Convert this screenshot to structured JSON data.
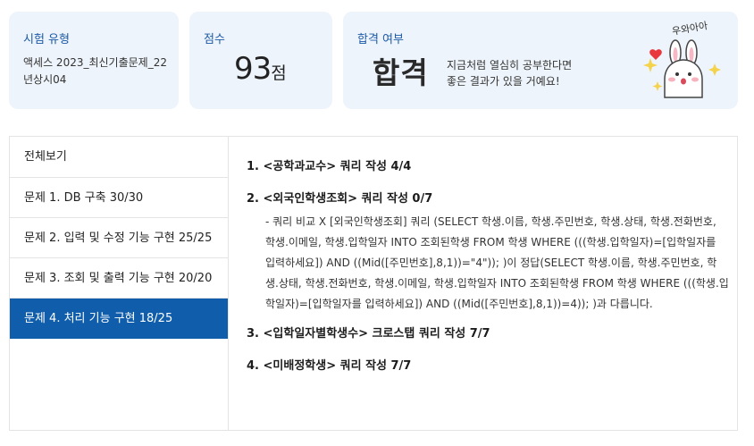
{
  "cards": {
    "exam_type": {
      "label": "시험 유형",
      "value": "액세스 2023_최신기출문제_22년상시04"
    },
    "score": {
      "label": "점수",
      "value": "93",
      "unit": "점"
    },
    "result": {
      "label": "합격 여부",
      "value": "합격",
      "message_line1": "지금처럼 열심히 공부한다면",
      "message_line2": "좋은 결과가 있을 거예요!",
      "mascot_text": "우와아아"
    }
  },
  "sidebar": {
    "items": [
      {
        "label": "전체보기",
        "active": false
      },
      {
        "label": "문제 1. DB 구축 30/30",
        "active": false
      },
      {
        "label": "문제 2. 입력 및 수정 기능 구현 25/25",
        "active": false
      },
      {
        "label": "문제 3. 조회 및 출력 기능 구현 20/20",
        "active": false
      },
      {
        "label": "문제 4. 처리 기능 구현 18/25",
        "active": true
      }
    ]
  },
  "questions": [
    {
      "title": "1. <공학과교수> 쿼리 작성 4/4"
    },
    {
      "title": "2. <외국인학생조회> 쿼리 작성 0/7",
      "detail": "- 쿼리 비교 X [외국인학생조회] 쿼리 (SELECT 학생.이름, 학생.주민번호, 학생.상태, 학생.전화번호, 학생.이메일, 학생.입학일자 INTO 조회된학생 FROM 학생 WHERE (((학생.입학일자)=[입학일자를 입력하세요]) AND ((Mid([주민번호],8,1))=\"4\")); )이 정답(SELECT 학생.이름, 학생.주민번호, 학생.상태, 학생.전화번호, 학생.이메일, 학생.입학일자 INTO 조회된학생 FROM 학생 WHERE (((학생.입학일자)=[입학일자를 입력하세요]) AND ((Mid([주민번호],8,1))=4)); )과 다릅니다."
    },
    {
      "title": "3. <입학일자별학생수> 크로스탭 쿼리 작성 7/7"
    },
    {
      "title": "4. <미배정학생> 쿼리 작성 7/7"
    }
  ],
  "colors": {
    "accent": "#0f5dab",
    "card_bg": "#eef4fb",
    "label_blue": "#1c5aa7"
  }
}
